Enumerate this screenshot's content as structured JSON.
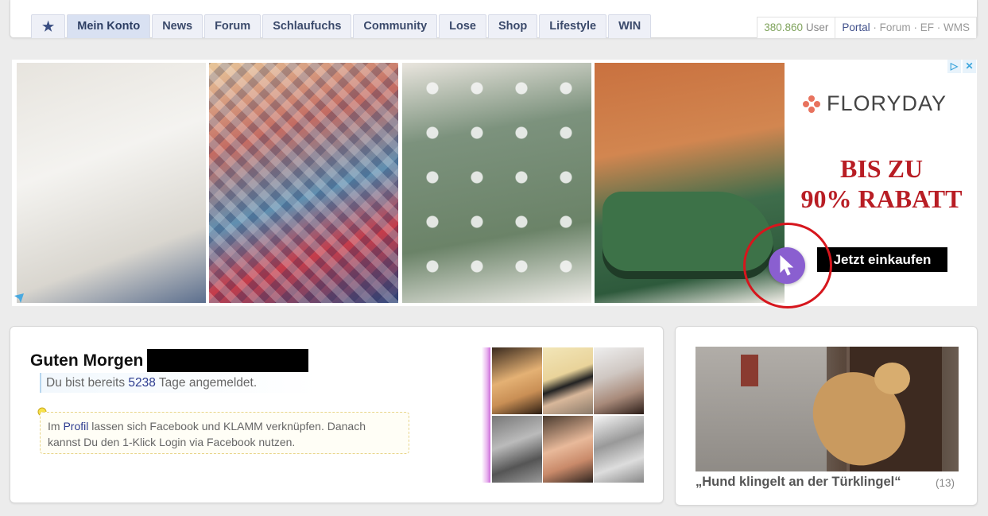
{
  "nav": {
    "star": "★",
    "tabs": [
      "Mein Konto",
      "News",
      "Forum",
      "Schlaufuchs",
      "Community",
      "Lose",
      "Shop",
      "Lifestyle",
      "WIN"
    ],
    "active_tab": "Mein Konto",
    "user_count": "380.860",
    "user_label": "User",
    "links": {
      "portal": "Portal",
      "sep": "·",
      "forum": "Forum",
      "ef": "EF",
      "wms": "WMS"
    }
  },
  "ad": {
    "brand": "FLORYDAY",
    "promo_line1": "BIS ZU",
    "promo_line2": "90% RABATT",
    "cta": "Jetzt einkaufen",
    "info_icons": [
      "▷",
      "✕"
    ],
    "colors": {
      "promo": "#b81d24",
      "cta_bg": "#000000",
      "highlight_ring": "#d6161d",
      "cursor_bubble": "#8a5fd0"
    }
  },
  "welcome": {
    "greeting": "Guten Morgen",
    "days_prefix": "Du bist bereits",
    "days_count": "5238",
    "days_suffix": "Tage angemeldet.",
    "tip_prefix": "Im",
    "tip_link": "Profil",
    "tip_text": "lassen sich Facebook und KLAMM verknüpfen. Danach kannst Du den 1-Klick Login via Facebook nutzen."
  },
  "video": {
    "title": "„Hund klingelt an der Türklingel“",
    "count": "(13)"
  }
}
